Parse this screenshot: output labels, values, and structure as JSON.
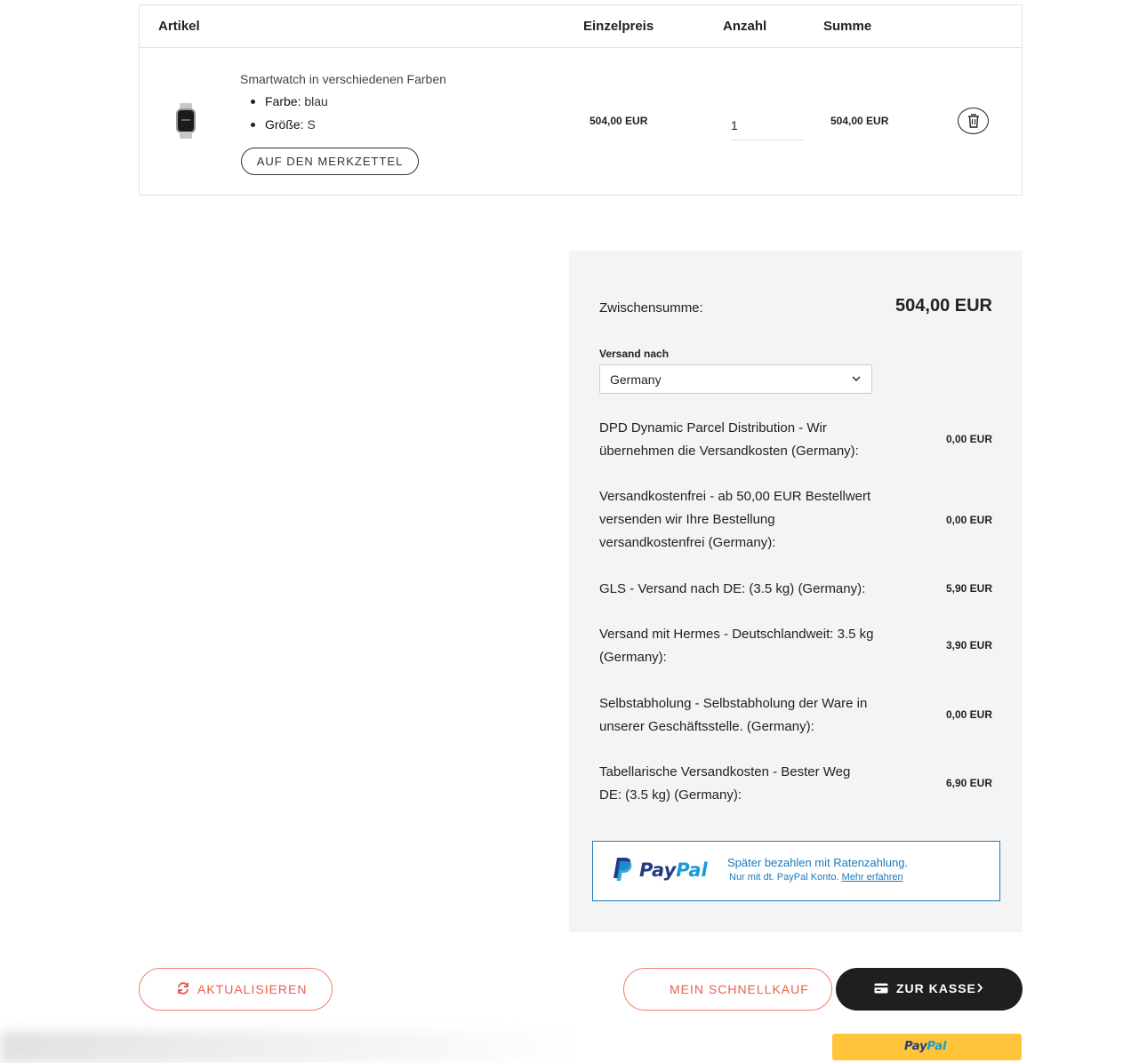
{
  "cart": {
    "headers": {
      "item": "Artikel",
      "unit_price": "Einzelpreis",
      "quantity": "Anzahl",
      "sum": "Summe"
    },
    "items": [
      {
        "title": "Smartwatch in verschiedenen Farben",
        "attributes": [
          {
            "key": "Farbe:",
            "value": "blau"
          },
          {
            "key": "Größe:",
            "value": "S"
          }
        ],
        "wishlist_label": "AUF DEN MERKZETTEL",
        "unit_price": "504,00 EUR",
        "quantity": "1",
        "sum": "504,00 EUR",
        "image_icon": "smartwatch-image",
        "delete_icon": "trash-icon"
      }
    ]
  },
  "totals": {
    "subtotal_label": "Zwischensumme:",
    "subtotal_value": "504,00 EUR",
    "shipping_to_label": "Versand nach",
    "country_selected": "Germany",
    "shipping_options": [
      {
        "name": "DPD Dynamic Parcel Distribution - Wir übernehmen die Versandkosten (Germany):",
        "cost": "0,00 EUR"
      },
      {
        "name": "Versandkostenfrei - ab 50,00 EUR Bestellwert versenden wir Ihre Bestellung versandkostenfrei (Germany):",
        "cost": "0,00 EUR"
      },
      {
        "name": "GLS - Versand nach DE: (3.5 kg) (Germany):",
        "cost": "5,90 EUR"
      },
      {
        "name": "Versand mit Hermes - Deutschlandweit: 3.5 kg (Germany):",
        "cost": "3,90 EUR"
      },
      {
        "name": "Selbstabholung - Selbstabholung der Ware in unserer Geschäftsstelle. (Germany):",
        "cost": "0,00 EUR"
      },
      {
        "name": "Tabellarische Versandkosten - Bester Weg DE: (3.5 kg) (Germany):",
        "cost": "6,90 EUR"
      }
    ],
    "paypal_banner": {
      "brand_pay": "Pay",
      "brand_pal": "Pal",
      "line1": "Später bezahlen mit Ratenzahlung.",
      "line2": "Nur mit dt. PayPal Konto.",
      "link": "Mehr erfahren"
    }
  },
  "actions": {
    "update_label": "AKTUALISIEREN",
    "quick_buy_label": "MEIN SCHNELLKAUF",
    "checkout_label": "ZUR KASSE",
    "paypal_button": {
      "pay": "Pay",
      "pal": "Pal"
    }
  },
  "colors": {
    "accent": "#e8604e",
    "dark_button": "#1f1f1f",
    "paypal_yellow": "#ffc439",
    "paypal_blue": "#1a7bc0",
    "panel_bg": "#f4f4f4"
  }
}
